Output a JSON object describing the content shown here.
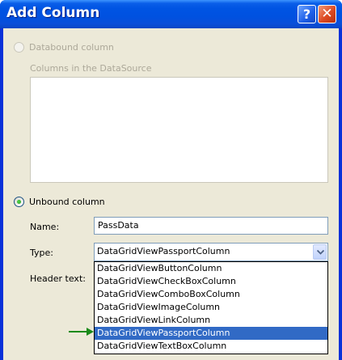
{
  "window": {
    "title": "Add Column",
    "help_glyph": "?",
    "close_glyph": "✕"
  },
  "databound": {
    "label": "Databound column",
    "checked": false,
    "enabled": false
  },
  "columns_list_label": "Columns in the DataSource",
  "unbound": {
    "label": "Unbound column",
    "checked": true
  },
  "name_field": {
    "label": "Name:",
    "value": "PassData"
  },
  "type_field": {
    "label": "Type:",
    "value": "DataGridViewPassportColumn"
  },
  "header_text_field": {
    "label": "Header text:"
  },
  "type_options": [
    "DataGridViewButtonColumn",
    "DataGridViewCheckBoxColumn",
    "DataGridViewComboBoxColumn",
    "DataGridViewImageColumn",
    "DataGridViewLinkColumn",
    "DataGridViewPassportColumn",
    "DataGridViewTextBoxColumn"
  ],
  "selected_option": "DataGridViewPassportColumn",
  "colors": {
    "title_bar": "#0054e3",
    "selection": "#316ac5",
    "dialog_bg": "#ece9d8",
    "pointer_arrow": "#1a8a1a"
  }
}
